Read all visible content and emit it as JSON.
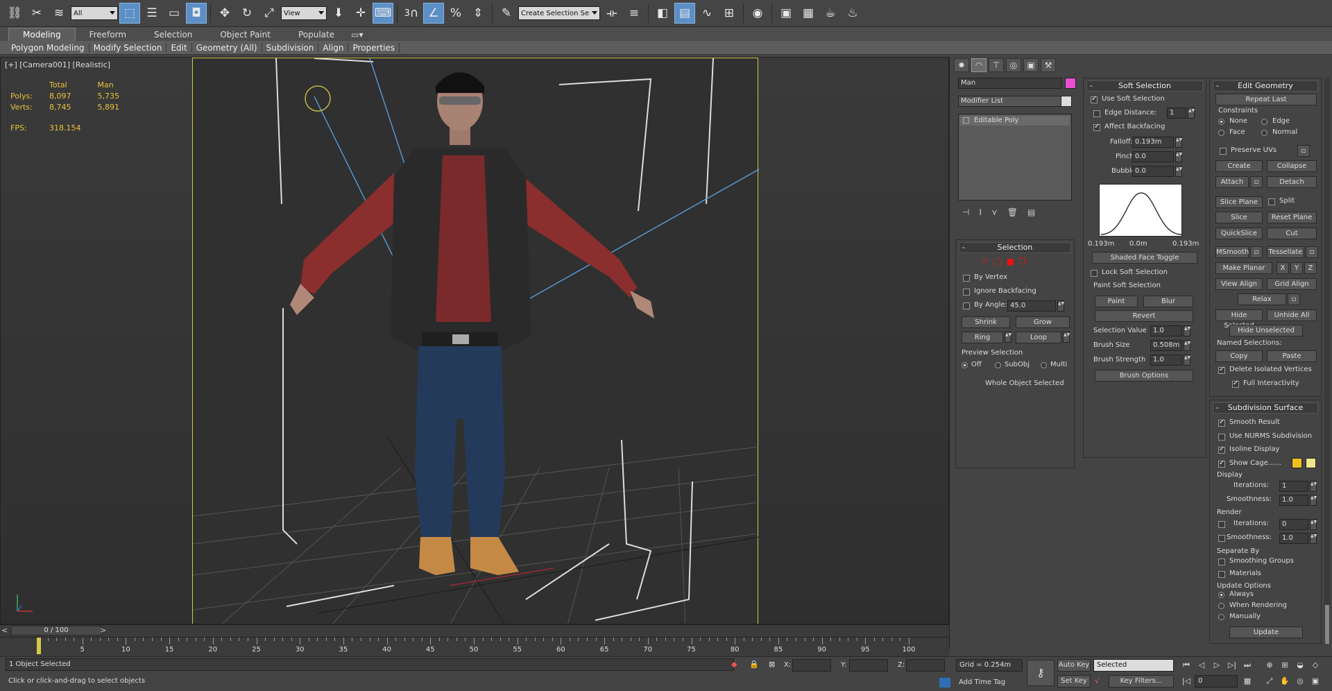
{
  "toolbar": {
    "selection_filter": "All",
    "ref_coord": "View",
    "named_sel_placeholder": "Create Selection Se",
    "snap_label": "3",
    "icons": [
      "link-icon",
      "unlink-icon",
      "bind-space-warp-icon",
      "select-object-icon",
      "select-by-name-icon",
      "rect-region-icon",
      "window-crossing-icon",
      "move-icon",
      "rotate-icon",
      "scale-icon",
      "select-manipulate-icon",
      "pivot-icon",
      "snap-icon",
      "angle-snap-icon",
      "percent-snap-icon",
      "spinner-snap-icon",
      "edit-named-sel-icon",
      "mirror-icon",
      "align-icon",
      "layer-icon",
      "scene-explorer-icon",
      "curve-editor-icon",
      "schematic-icon",
      "material-editor-icon",
      "render-setup-icon",
      "render-frame-icon",
      "render-icon",
      "teapot-icon"
    ]
  },
  "ribbon": {
    "tabs": [
      "Modeling",
      "Freeform",
      "Selection",
      "Object Paint",
      "Populate"
    ],
    "active_tab": "Modeling",
    "bar_items": [
      "Polygon Modeling",
      "Modify Selection",
      "Edit",
      "Geometry (All)",
      "Subdivision",
      "Align",
      "Properties"
    ]
  },
  "viewport": {
    "label": "[+] [Camera001] [Realistic]",
    "stats": {
      "col_total": "Total",
      "col_object": "Man",
      "polys_label": "Polys:",
      "polys_total": "8,097",
      "polys_obj": "5,735",
      "verts_label": "Verts:",
      "verts_total": "8,745",
      "verts_obj": "5,891",
      "fps_label": "FPS:",
      "fps": "318.154"
    }
  },
  "command_panel": {
    "object_name": "Man",
    "object_color": "#e84fd4",
    "modifier_list": "Modifier List",
    "stack": [
      "Editable Poly"
    ],
    "selection": {
      "title": "Selection",
      "by_vertex": "By Vertex",
      "ignore_backfacing": "Ignore Backfacing",
      "by_angle": "By Angle:",
      "by_angle_value": "45.0",
      "shrink": "Shrink",
      "grow": "Grow",
      "ring": "Ring",
      "loop": "Loop",
      "preview_title": "Preview Selection",
      "off": "Off",
      "subobj": "SubObj",
      "multi": "Multi",
      "status": "Whole Object Selected"
    },
    "soft_selection": {
      "title": "Soft Selection",
      "use_soft": "Use Soft Selection",
      "edge_distance": "Edge Distance:",
      "edge_distance_value": "1",
      "affect_backfacing": "Affect Backfacing",
      "falloff": "Falloff:",
      "falloff_value": "0.193m",
      "pinch": "Pinch:",
      "pinch_value": "0.0",
      "bubble": "Bubble:",
      "bubble_value": "0.0",
      "curve_left": "0.193m",
      "curve_mid": "0.0m",
      "curve_right": "0.193m",
      "shaded_face_toggle": "Shaded Face Toggle",
      "lock_soft": "Lock Soft Selection",
      "paint_title": "Paint Soft Selection",
      "paint": "Paint",
      "blur": "Blur",
      "revert": "Revert",
      "selection_value": "Selection Value",
      "selection_value_num": "1.0",
      "brush_size": "Brush Size",
      "brush_size_num": "0.508m",
      "brush_strength": "Brush Strength",
      "brush_strength_num": "1.0",
      "brush_options": "Brush Options"
    },
    "edit_geometry": {
      "title": "Edit Geometry",
      "repeat_last": "Repeat Last",
      "constraints": "Constraints",
      "none": "None",
      "edge": "Edge",
      "face": "Face",
      "normal": "Normal",
      "preserve_uvs": "Preserve UVs",
      "create": "Create",
      "collapse": "Collapse",
      "attach": "Attach",
      "detach": "Detach",
      "slice_plane": "Slice Plane",
      "split": "Split",
      "slice": "Slice",
      "reset_plane": "Reset Plane",
      "quickslice": "QuickSlice",
      "cut": "Cut",
      "msmooth": "MSmooth",
      "tessellate": "Tessellate",
      "make_planar": "Make Planar",
      "x": "X",
      "y": "Y",
      "z": "Z",
      "view_align": "View Align",
      "grid_align": "Grid Align",
      "relax": "Relax",
      "hide_selected": "Hide Selected",
      "unhide_all": "Unhide All",
      "hide_unselected": "Hide Unselected",
      "named_selections": "Named Selections:",
      "copy": "Copy",
      "paste": "Paste",
      "delete_isolated": "Delete Isolated Vertices",
      "full_interactivity": "Full Interactivity"
    },
    "subdivision": {
      "title": "Subdivision Surface",
      "smooth_result": "Smooth Result",
      "use_nurms": "Use NURMS Subdivision",
      "isoline": "Isoline Display",
      "show_cage": "Show Cage......",
      "cage_color1": "#f2c01e",
      "cage_color2": "#f0e68c",
      "display": "Display",
      "iterations": "Iterations:",
      "disp_iter": "1",
      "smoothness": "Smoothness:",
      "disp_smooth": "1.0",
      "render": "Render",
      "rend_iter": "0",
      "rend_smooth": "1.0",
      "separate_by": "Separate By",
      "smoothing_groups": "Smoothing Groups",
      "materials": "Materials",
      "update_options": "Update Options",
      "always": "Always",
      "when_rendering": "When Rendering",
      "manually": "Manually",
      "update": "Update"
    }
  },
  "timeline": {
    "position": "0 / 100",
    "ticks": [
      "0",
      "5",
      "10",
      "15",
      "20",
      "25",
      "30",
      "35",
      "40",
      "45",
      "50",
      "55",
      "60",
      "65",
      "70",
      "75",
      "80",
      "85",
      "90",
      "95",
      "100"
    ]
  },
  "status": {
    "selected": "1 Object Selected",
    "prompt": "Click or click-and-drag to select objects",
    "x_label": "X:",
    "y_label": "Y:",
    "z_label": "Z:",
    "grid": "Grid = 0.254m",
    "add_time_tag": "Add Time Tag",
    "auto_key": "Auto Key",
    "set_key": "Set Key",
    "key_mode": "Selected",
    "key_filters": "Key Filters...",
    "frame": "0"
  }
}
